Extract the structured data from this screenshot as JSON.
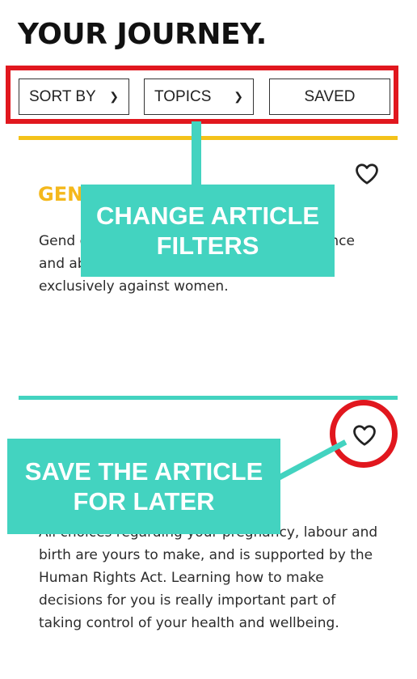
{
  "header": {
    "title": "YOUR JOURNEY."
  },
  "filters": {
    "sort_label": "SORT BY",
    "topics_label": "TOPICS",
    "saved_label": "SAVED"
  },
  "articles": [
    {
      "title": "GEN",
      "desc": "Gend                                                                e descr                                                              ch cover a spectrum of violence and abuse committed primarily but not exclusively against women."
    },
    {
      "desc": "All choices regarding your pregnancy, labour and birth are yours to make, and is supported by the Human Rights Act. Learning how to make decisions for you is really important part of taking control of your health and wellbeing."
    }
  ],
  "annotations": {
    "filters_callout": "CHANGE ARTICLE FILTERS",
    "save_callout": "SAVE THE ARTICLE FOR LATER"
  },
  "colors": {
    "accent_teal": "#43d3c0",
    "highlight_red": "#e1171e",
    "title_yellow": "#f4b81c",
    "divider_yellow": "#f4c21a"
  },
  "icons": {
    "favorite": "heart-outline-icon",
    "dropdown": "chevron-down-icon"
  }
}
